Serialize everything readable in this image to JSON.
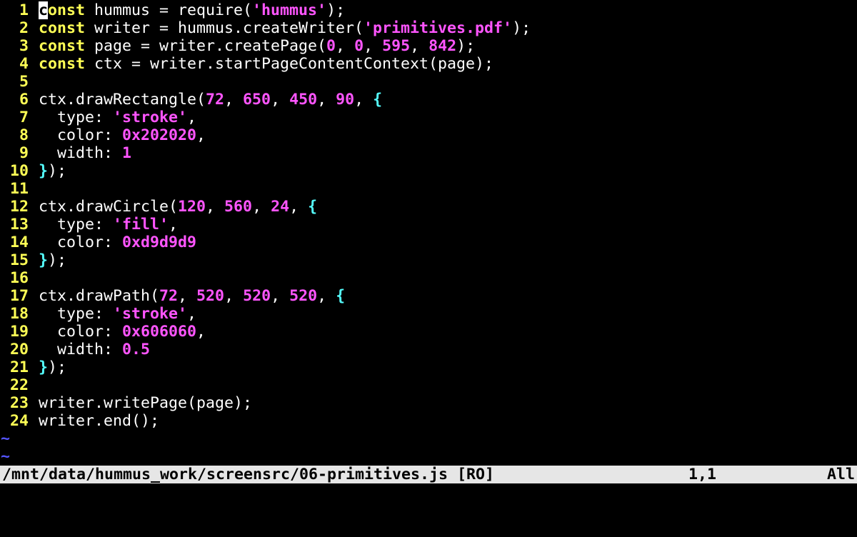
{
  "editor": {
    "cursor_char": "c",
    "lines": [
      {
        "num": "1",
        "tokens": [
          {
            "t": "kw",
            "v": "onst"
          },
          {
            "t": "plain",
            "v": " hummus = require("
          },
          {
            "t": "str",
            "v": "'hummus'"
          },
          {
            "t": "plain",
            "v": ");"
          }
        ]
      },
      {
        "num": "2",
        "tokens": [
          {
            "t": "kw",
            "v": "const"
          },
          {
            "t": "plain",
            "v": " writer = hummus.createWriter("
          },
          {
            "t": "str",
            "v": "'primitives.pdf'"
          },
          {
            "t": "plain",
            "v": ");"
          }
        ]
      },
      {
        "num": "3",
        "tokens": [
          {
            "t": "kw",
            "v": "const"
          },
          {
            "t": "plain",
            "v": " page = writer.createPage("
          },
          {
            "t": "num",
            "v": "0"
          },
          {
            "t": "plain",
            "v": ", "
          },
          {
            "t": "num",
            "v": "0"
          },
          {
            "t": "plain",
            "v": ", "
          },
          {
            "t": "num",
            "v": "595"
          },
          {
            "t": "plain",
            "v": ", "
          },
          {
            "t": "num",
            "v": "842"
          },
          {
            "t": "plain",
            "v": ");"
          }
        ]
      },
      {
        "num": "4",
        "tokens": [
          {
            "t": "kw",
            "v": "const"
          },
          {
            "t": "plain",
            "v": " ctx = writer.startPageContentContext(page);"
          }
        ]
      },
      {
        "num": "5",
        "tokens": []
      },
      {
        "num": "6",
        "tokens": [
          {
            "t": "plain",
            "v": "ctx.drawRectangle("
          },
          {
            "t": "num",
            "v": "72"
          },
          {
            "t": "plain",
            "v": ", "
          },
          {
            "t": "num",
            "v": "650"
          },
          {
            "t": "plain",
            "v": ", "
          },
          {
            "t": "num",
            "v": "450"
          },
          {
            "t": "plain",
            "v": ", "
          },
          {
            "t": "num",
            "v": "90"
          },
          {
            "t": "plain",
            "v": ", "
          },
          {
            "t": "brace",
            "v": "{"
          }
        ]
      },
      {
        "num": "7",
        "tokens": [
          {
            "t": "plain",
            "v": "  type: "
          },
          {
            "t": "str",
            "v": "'stroke'"
          },
          {
            "t": "plain",
            "v": ","
          }
        ]
      },
      {
        "num": "8",
        "tokens": [
          {
            "t": "plain",
            "v": "  color: "
          },
          {
            "t": "num",
            "v": "0x202020"
          },
          {
            "t": "plain",
            "v": ","
          }
        ]
      },
      {
        "num": "9",
        "tokens": [
          {
            "t": "plain",
            "v": "  width: "
          },
          {
            "t": "num",
            "v": "1"
          }
        ]
      },
      {
        "num": "10",
        "tokens": [
          {
            "t": "brace",
            "v": "}"
          },
          {
            "t": "plain",
            "v": ");"
          }
        ]
      },
      {
        "num": "11",
        "tokens": []
      },
      {
        "num": "12",
        "tokens": [
          {
            "t": "plain",
            "v": "ctx.drawCircle("
          },
          {
            "t": "num",
            "v": "120"
          },
          {
            "t": "plain",
            "v": ", "
          },
          {
            "t": "num",
            "v": "560"
          },
          {
            "t": "plain",
            "v": ", "
          },
          {
            "t": "num",
            "v": "24"
          },
          {
            "t": "plain",
            "v": ", "
          },
          {
            "t": "brace",
            "v": "{"
          }
        ]
      },
      {
        "num": "13",
        "tokens": [
          {
            "t": "plain",
            "v": "  type: "
          },
          {
            "t": "str",
            "v": "'fill'"
          },
          {
            "t": "plain",
            "v": ","
          }
        ]
      },
      {
        "num": "14",
        "tokens": [
          {
            "t": "plain",
            "v": "  color: "
          },
          {
            "t": "num",
            "v": "0xd9d9d9"
          }
        ]
      },
      {
        "num": "15",
        "tokens": [
          {
            "t": "brace",
            "v": "}"
          },
          {
            "t": "plain",
            "v": ");"
          }
        ]
      },
      {
        "num": "16",
        "tokens": []
      },
      {
        "num": "17",
        "tokens": [
          {
            "t": "plain",
            "v": "ctx.drawPath("
          },
          {
            "t": "num",
            "v": "72"
          },
          {
            "t": "plain",
            "v": ", "
          },
          {
            "t": "num",
            "v": "520"
          },
          {
            "t": "plain",
            "v": ", "
          },
          {
            "t": "num",
            "v": "520"
          },
          {
            "t": "plain",
            "v": ", "
          },
          {
            "t": "num",
            "v": "520"
          },
          {
            "t": "plain",
            "v": ", "
          },
          {
            "t": "brace",
            "v": "{"
          }
        ]
      },
      {
        "num": "18",
        "tokens": [
          {
            "t": "plain",
            "v": "  type: "
          },
          {
            "t": "str",
            "v": "'stroke'"
          },
          {
            "t": "plain",
            "v": ","
          }
        ]
      },
      {
        "num": "19",
        "tokens": [
          {
            "t": "plain",
            "v": "  color: "
          },
          {
            "t": "num",
            "v": "0x606060"
          },
          {
            "t": "plain",
            "v": ","
          }
        ]
      },
      {
        "num": "20",
        "tokens": [
          {
            "t": "plain",
            "v": "  width: "
          },
          {
            "t": "num",
            "v": "0.5"
          }
        ]
      },
      {
        "num": "21",
        "tokens": [
          {
            "t": "brace",
            "v": "}"
          },
          {
            "t": "plain",
            "v": ");"
          }
        ]
      },
      {
        "num": "22",
        "tokens": []
      },
      {
        "num": "23",
        "tokens": [
          {
            "t": "plain",
            "v": "writer.writePage(page);"
          }
        ]
      },
      {
        "num": "24",
        "tokens": [
          {
            "t": "plain",
            "v": "writer.end();"
          }
        ]
      }
    ],
    "tilde_lines": [
      "~",
      "~"
    ]
  },
  "statusbar": {
    "file": "/mnt/data/hummus_work/screensrc/06-primitives.js [RO]",
    "position": "1,1",
    "scroll": "All"
  },
  "colors": {
    "background": "#000000",
    "line_number": "#ffff55",
    "keyword": "#ffff55",
    "string_number": "#ff55ff",
    "brace": "#55ffff",
    "tilde": "#5555ff",
    "statusbar_bg": "#e6e6e6"
  }
}
